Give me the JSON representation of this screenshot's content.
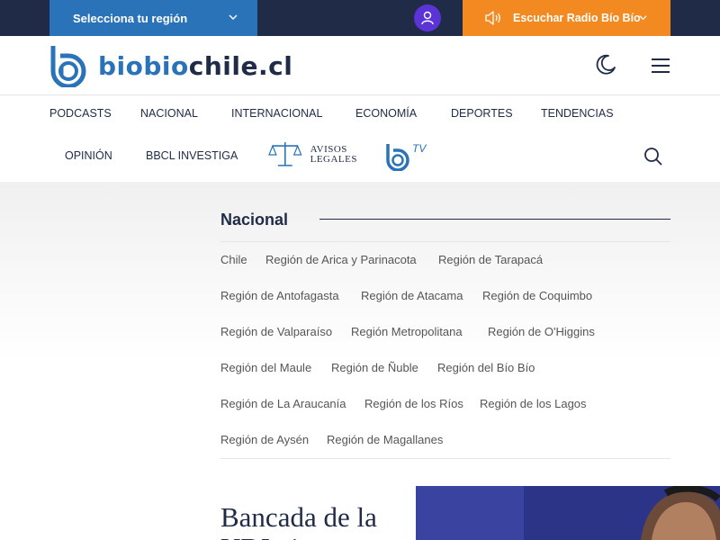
{
  "topbar": {
    "region_select_label": "Selecciona tu región",
    "radio_label": "Escuchar Radio Bío Bío"
  },
  "header": {
    "logo_part1": "biobio",
    "logo_part2": "chile.cl"
  },
  "nav": {
    "row1": [
      "PODCASTS",
      "NACIONAL",
      "INTERNACIONAL",
      "ECONOMÍA",
      "DEPORTES",
      "TENDENCIAS"
    ],
    "row2": [
      "OPINIÓN",
      "BBCL INVESTIGA"
    ],
    "avisos_line1": "AVISOS",
    "avisos_line2": "LEGALES",
    "tv_label": "TV"
  },
  "section": {
    "title": "Nacional",
    "regions": [
      "Chile",
      "Región de Arica y Parinacota",
      "Región de Tarapacá",
      "Región de Antofagasta",
      "Región de Atacama",
      "Región de Coquimbo",
      "Región de Valparaíso",
      "Región Metropolitana",
      "Región de O'Higgins",
      "Región del Maule",
      "Región de Ñuble",
      "Región del Bío Bío",
      "Región de La Araucanía",
      "Región de los Ríos",
      "Región de los Lagos",
      "Región de Aysén",
      "Región de Magallanes"
    ]
  },
  "article": {
    "title_visible": "Bancada de la UDI pi"
  },
  "colors": {
    "navy": "#1f2b47",
    "blue": "#2a73b8",
    "orange": "#f28a21",
    "purple": "#5b33d6"
  }
}
